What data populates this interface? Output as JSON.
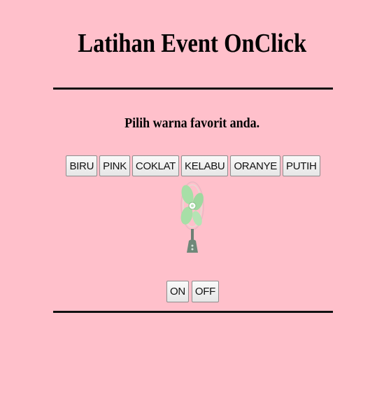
{
  "page": {
    "title": "Latihan Event OnClick",
    "prompt": "Pilih warna favorit anda."
  },
  "color_buttons": [
    {
      "label": "BIRU"
    },
    {
      "label": "PINK"
    },
    {
      "label": "COKLAT"
    },
    {
      "label": "KELABU"
    },
    {
      "label": "ORANYE"
    },
    {
      "label": "PUTIH"
    }
  ],
  "fan": {
    "icon": "fan-icon",
    "blade_color": "#a7dfa7",
    "state": "off"
  },
  "power_buttons": {
    "on_label": "ON",
    "off_label": "OFF"
  },
  "colors": {
    "background": "#ffc0cb",
    "divider": "#111111"
  }
}
